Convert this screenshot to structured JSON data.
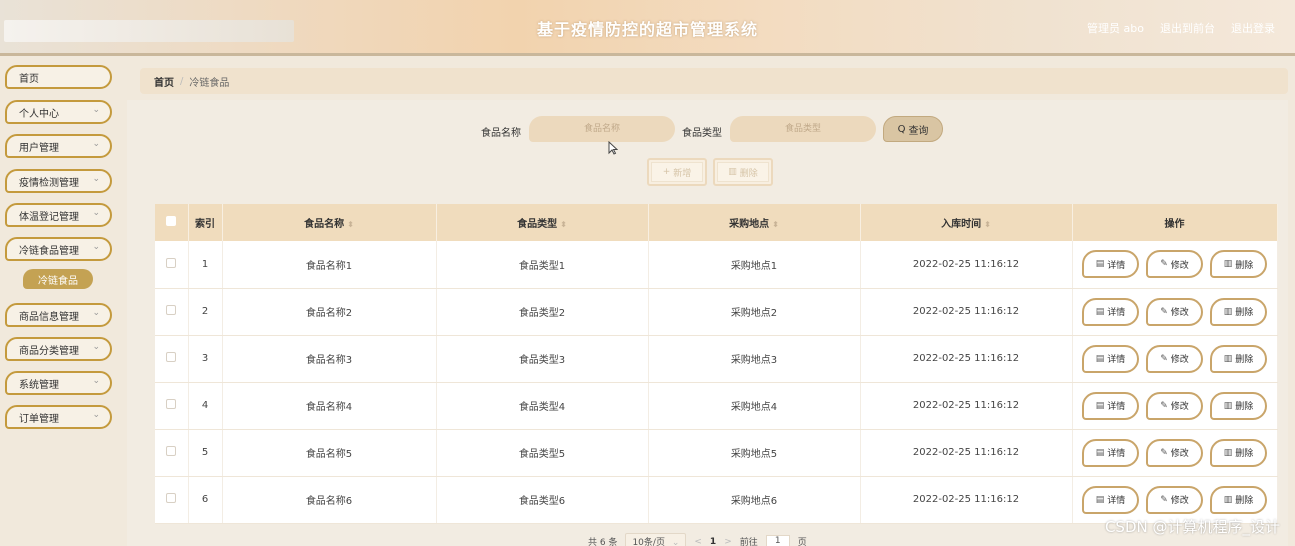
{
  "header": {
    "title": "基于疫情防控的超市管理系统",
    "admin_label": "管理员 abo",
    "to_front": "退出到前台",
    "logout": "退出登录"
  },
  "sidebar": {
    "items": [
      {
        "label": "首页",
        "has_chevron": false
      },
      {
        "label": "个人中心",
        "has_chevron": true
      },
      {
        "label": "用户管理",
        "has_chevron": true
      },
      {
        "label": "疫情检测管理",
        "has_chevron": true
      },
      {
        "label": "体温登记管理",
        "has_chevron": true
      },
      {
        "label": "冷链食品管理",
        "has_chevron": true
      },
      {
        "label": "商品信息管理",
        "has_chevron": true
      },
      {
        "label": "商品分类管理",
        "has_chevron": true
      },
      {
        "label": "系统管理",
        "has_chevron": true
      },
      {
        "label": "订单管理",
        "has_chevron": true
      }
    ],
    "active_sub": "冷链食品",
    "chevron": "⌄"
  },
  "breadcrumb": {
    "home": "首页",
    "sep": "/",
    "current": "冷链食品"
  },
  "search": {
    "name_label": "食品名称",
    "name_placeholder": "食品名称",
    "type_label": "食品类型",
    "type_placeholder": "食品类型",
    "query_icon": "Q",
    "query_label": "查询"
  },
  "actions": {
    "add_icon": "+",
    "add_label": "新增",
    "delete_icon": "▥",
    "delete_label": "删除"
  },
  "table": {
    "headers": [
      "索引",
      "食品名称",
      "食品类型",
      "采购地点",
      "入库时间",
      "操作"
    ],
    "sort_icon": "⬍",
    "rows": [
      {
        "index": "1",
        "name": "食品名称1",
        "type": "食品类型1",
        "place": "采购地点1",
        "time": "2022-02-25 11:16:12"
      },
      {
        "index": "2",
        "name": "食品名称2",
        "type": "食品类型2",
        "place": "采购地点2",
        "time": "2022-02-25 11:16:12"
      },
      {
        "index": "3",
        "name": "食品名称3",
        "type": "食品类型3",
        "place": "采购地点3",
        "time": "2022-02-25 11:16:12"
      },
      {
        "index": "4",
        "name": "食品名称4",
        "type": "食品类型4",
        "place": "采购地点4",
        "time": "2022-02-25 11:16:12"
      },
      {
        "index": "5",
        "name": "食品名称5",
        "type": "食品类型5",
        "place": "采购地点5",
        "time": "2022-02-25 11:16:12"
      },
      {
        "index": "6",
        "name": "食品名称6",
        "type": "食品类型6",
        "place": "采购地点6",
        "time": "2022-02-25 11:16:12"
      }
    ],
    "ops": [
      {
        "icon": "▤",
        "label": "详情"
      },
      {
        "icon": "✎",
        "label": "修改"
      },
      {
        "icon": "▥",
        "label": "删除"
      }
    ]
  },
  "pagination": {
    "total": "共 6 条",
    "page_size": "10条/页",
    "page_size_chevron": "⌄",
    "prev": "<",
    "current": "1",
    "next": ">",
    "goto_label": "前往",
    "goto_value": "1",
    "page_suffix": "页"
  },
  "watermark": "CSDN @计算机程序_设计",
  "colors": {
    "accent": "#c49a3d",
    "header_bg": "#f2d3ae",
    "table_header_bg": "#f0dcbd"
  }
}
